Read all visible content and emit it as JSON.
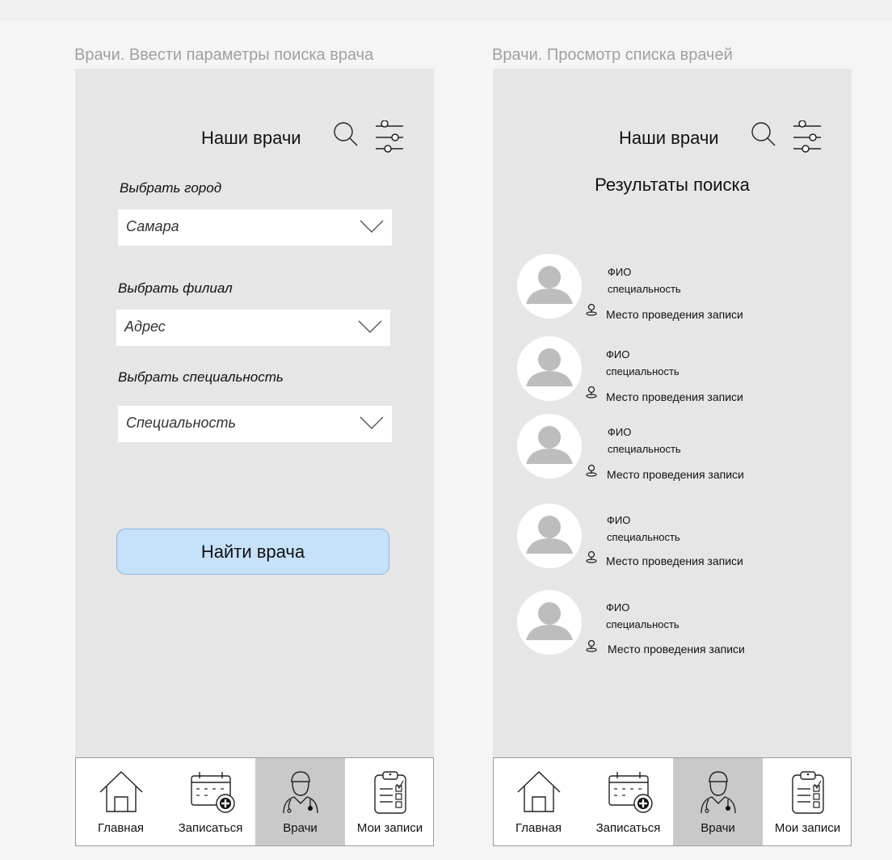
{
  "frames": [
    {
      "label": "Врачи. Ввести параметры поиска врача",
      "header_title": "Наши врачи",
      "fields": [
        {
          "label": "Выбрать город",
          "value": "Самара"
        },
        {
          "label": "Выбрать филиал",
          "value": "Адрес"
        },
        {
          "label": "Выбрать специальность",
          "value": "Специальность"
        }
      ],
      "search_button": "Найти врача"
    },
    {
      "label": "Врачи. Просмотр списка врачей",
      "header_title": "Наши врачи",
      "results_title": "Результаты поиска",
      "doctors": [
        {
          "name": "ФИО",
          "specialty": "специальность",
          "place": "Место проведения записи"
        },
        {
          "name": "ФИО",
          "specialty": "специальность",
          "place": "Место проведения записи"
        },
        {
          "name": "ФИО",
          "specialty": "специальность",
          "place": "Место проведения записи"
        },
        {
          "name": "ФИО",
          "specialty": "специальность",
          "place": "Место проведения записи"
        },
        {
          "name": "ФИО",
          "specialty": "специальность",
          "place": "Место проведения записи"
        }
      ]
    }
  ],
  "nav": [
    {
      "label": "Главная",
      "icon": "home-icon",
      "active": false
    },
    {
      "label": "Записаться",
      "icon": "calendar-add-icon",
      "active": false
    },
    {
      "label": "Врачи",
      "icon": "doctor-icon",
      "active": true
    },
    {
      "label": "Мои записи",
      "icon": "clipboard-icon",
      "active": false
    }
  ],
  "colors": {
    "frame_bg": "#e6e6e6",
    "button_bg": "#c6e1fa",
    "nav_active_bg": "#c9c9c9",
    "avatar_fill": "#bdbdbd"
  }
}
